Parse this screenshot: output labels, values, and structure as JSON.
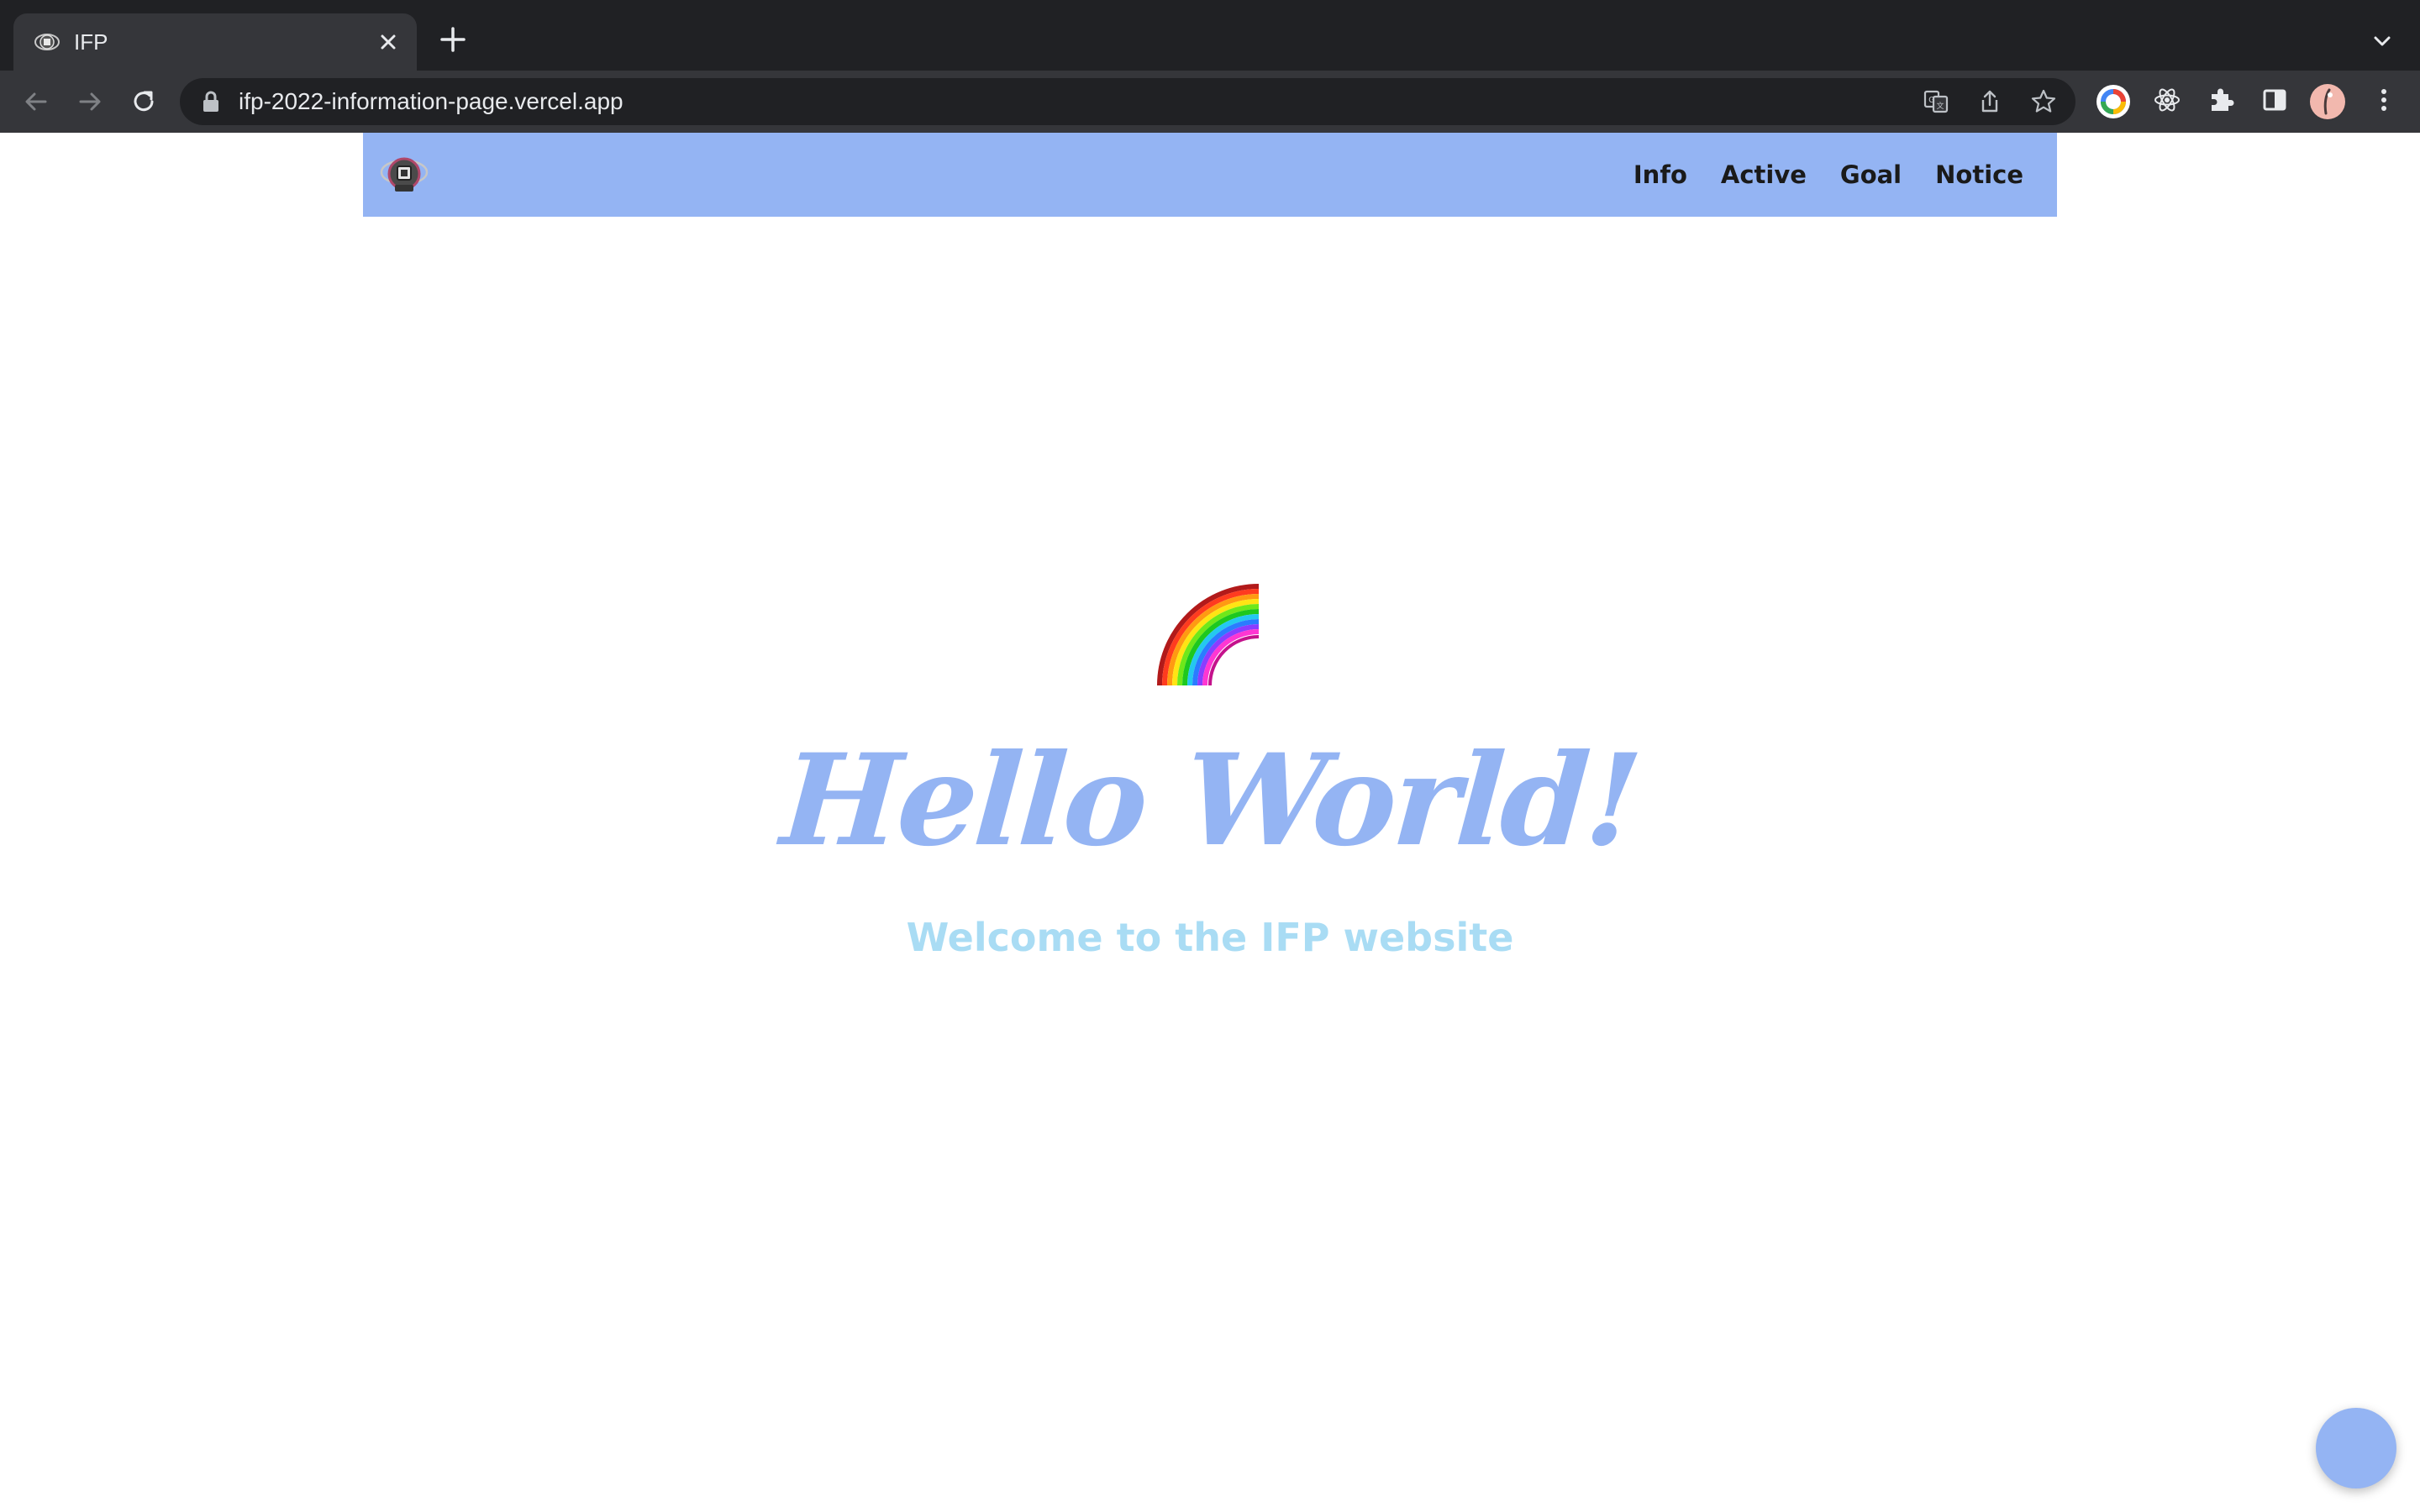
{
  "browser": {
    "tab": {
      "title": "IFP",
      "favicon": "site-logo-icon"
    },
    "omnibox": {
      "url": "ifp-2022-information-page.vercel.app"
    },
    "icons": {
      "back": "arrow-left-icon",
      "forward": "arrow-right-icon",
      "reload": "reload-icon",
      "translate": "translate-icon",
      "share": "share-icon",
      "bookmark": "star-icon",
      "extensions": "puzzle-icon",
      "side_panel": "side-panel-icon",
      "menu": "kebab-menu-icon"
    }
  },
  "navbar": {
    "links": [
      "Info",
      "Active",
      "Goal",
      "Notice"
    ],
    "background": "#94b4f3"
  },
  "hero": {
    "emoji": "rainbow-icon",
    "title": "Hello World!",
    "subtitle": "Welcome to the IFP website",
    "title_color": "#94b4f3",
    "subtitle_color": "#a9dcf4"
  },
  "colors": {
    "accent": "#94b4f3",
    "chrome_dark": "#202124",
    "chrome_mid": "#35363a"
  }
}
